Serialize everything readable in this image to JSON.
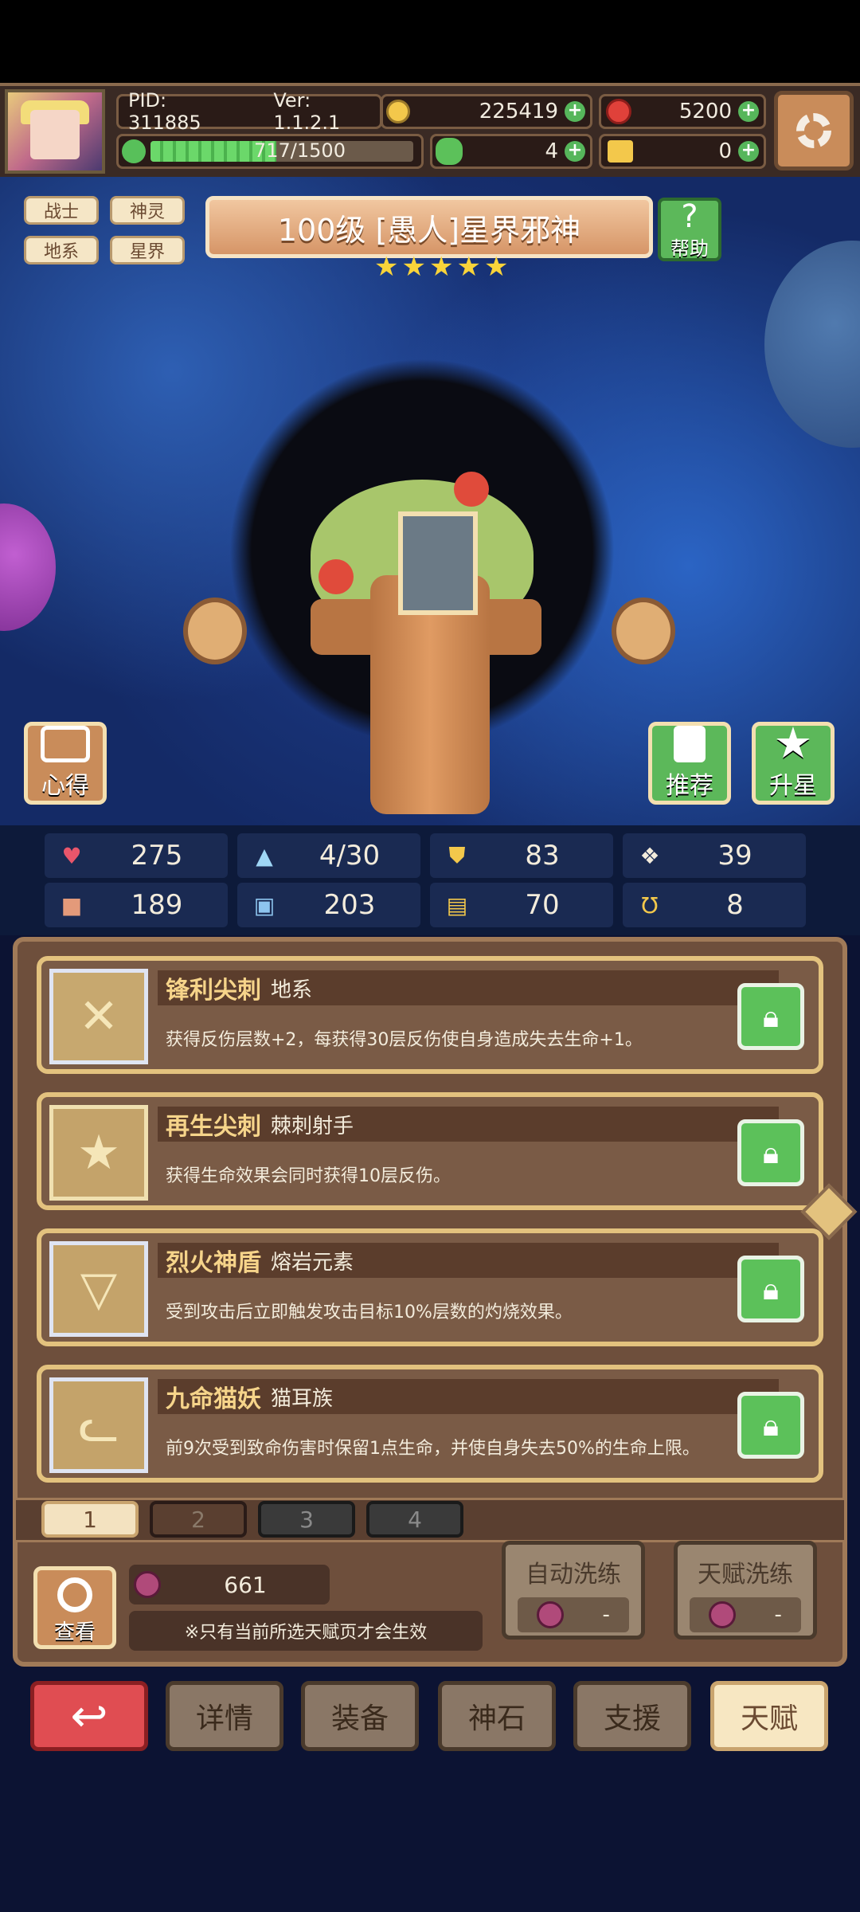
{
  "hud": {
    "pid": "PID: 311885",
    "version": "Ver: 1.1.2.1",
    "gold": "225419",
    "gems": "5200",
    "exp": "717/1500",
    "clover": "4",
    "key_item": "0"
  },
  "tags": [
    "战士",
    "神灵",
    "地系",
    "星界"
  ],
  "hero": {
    "title": "100级 [愚人]星界邪神",
    "stars": 5,
    "help_label": "帮助",
    "insight_label": "心得",
    "recommend_label": "推荐",
    "upstar_label": "升星"
  },
  "stats": {
    "hp": "275",
    "mana": "4/30",
    "armor": "83",
    "speed": "39",
    "attack": "189",
    "magic": "203",
    "item": "70",
    "crit": "8"
  },
  "talents": [
    {
      "name": "锋利尖刺",
      "tag": "地系",
      "desc": "获得反伤层数+2，每获得30层反伤使自身造成失去生命+1。",
      "icon": "sword-icon"
    },
    {
      "name": "再生尖刺",
      "tag": "棘刺射手",
      "desc": "获得生命效果会同时获得10层反伤。",
      "icon": "star-icon"
    },
    {
      "name": "烈火神盾",
      "tag": "熔岩元素",
      "desc": "受到攻击后立即触发攻击目标10%层数的灼烧效果。",
      "icon": "triangle-icon"
    },
    {
      "name": "九命猫妖",
      "tag": "猫耳族",
      "desc": "前9次受到致命伤害时保留1点生命，并使自身失去50%的生命上限。",
      "icon": "cat-icon"
    }
  ],
  "pages": [
    "1",
    "2",
    "3",
    "4"
  ],
  "bottom": {
    "view_label": "查看",
    "berries": "661",
    "note": "※只有当前所选天赋页才会生效",
    "auto_wash": "自动洗练",
    "talent_wash": "天赋洗练",
    "auto_wash_cost": "-",
    "talent_wash_cost": "-"
  },
  "nav": {
    "details": "详情",
    "equip": "装备",
    "stone": "神石",
    "support": "支援",
    "talent": "天赋"
  }
}
